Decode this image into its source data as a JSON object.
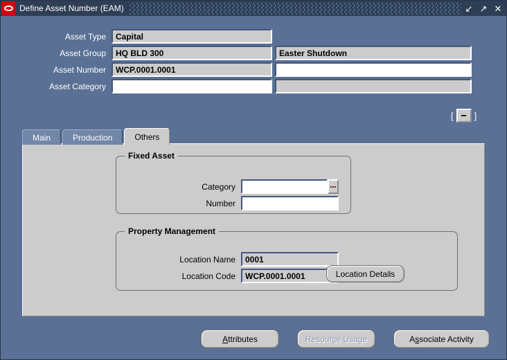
{
  "window": {
    "title": "Define Asset Number (EAM)",
    "logo_icon": "oracle-logo-icon",
    "controls": {
      "minimize": "↙",
      "maximize": "↗",
      "close": "✕"
    },
    "colors": {
      "window_background": "#5a7094",
      "title_bar": "#2e3e55",
      "panel": "#cccccc",
      "logo_red": "#d4000d",
      "field_readonly": "#cccccc",
      "field_editable": "#ffffff",
      "disabled_text": "#8d9cb5"
    }
  },
  "header": {
    "rows": [
      {
        "label": "Asset Type",
        "left_value": "Capital",
        "left_readonly": true,
        "right_value": "",
        "right_readonly": true,
        "right_visible": false
      },
      {
        "label": "Asset Group",
        "left_value": "HQ BLD 300",
        "left_readonly": true,
        "right_value": "Easter Shutdown",
        "right_readonly": true,
        "right_visible": true
      },
      {
        "label": "Asset Number",
        "left_value": "WCP.0001.0001",
        "left_readonly": true,
        "right_value": "",
        "right_readonly": false,
        "right_visible": true
      },
      {
        "label": "Asset Category",
        "left_value": "",
        "left_readonly": false,
        "right_value": "",
        "right_readonly": true,
        "right_visible": true
      }
    ]
  },
  "flexfield": {
    "open_bracket": "[",
    "close_bracket": "]",
    "button_label": ""
  },
  "tabs": [
    {
      "label": "Main",
      "active": false
    },
    {
      "label": "Production",
      "active": false
    },
    {
      "label": "Others",
      "active": true
    }
  ],
  "others_tab": {
    "fixed_asset": {
      "title": "Fixed Asset",
      "fields": [
        {
          "label": "Category",
          "value": "",
          "readonly": false,
          "has_lov": true
        },
        {
          "label": "Number",
          "value": "",
          "readonly": false,
          "has_lov": false
        }
      ]
    },
    "property_management": {
      "title": "Property Management",
      "fields": [
        {
          "label": "Location Name",
          "value": "0001",
          "readonly": true
        },
        {
          "label": "Location Code",
          "value": "WCP.0001.0001",
          "readonly": true
        }
      ],
      "details_button": {
        "label": "Location Details",
        "enabled": true
      }
    }
  },
  "footer": {
    "buttons": [
      {
        "label": "Attributes",
        "mnemonic_index": 0,
        "enabled": true
      },
      {
        "label": "Resource Usage",
        "mnemonic_index": 6,
        "enabled": false
      },
      {
        "label": "Associate Activity",
        "mnemonic_index": 1,
        "enabled": true
      }
    ]
  }
}
